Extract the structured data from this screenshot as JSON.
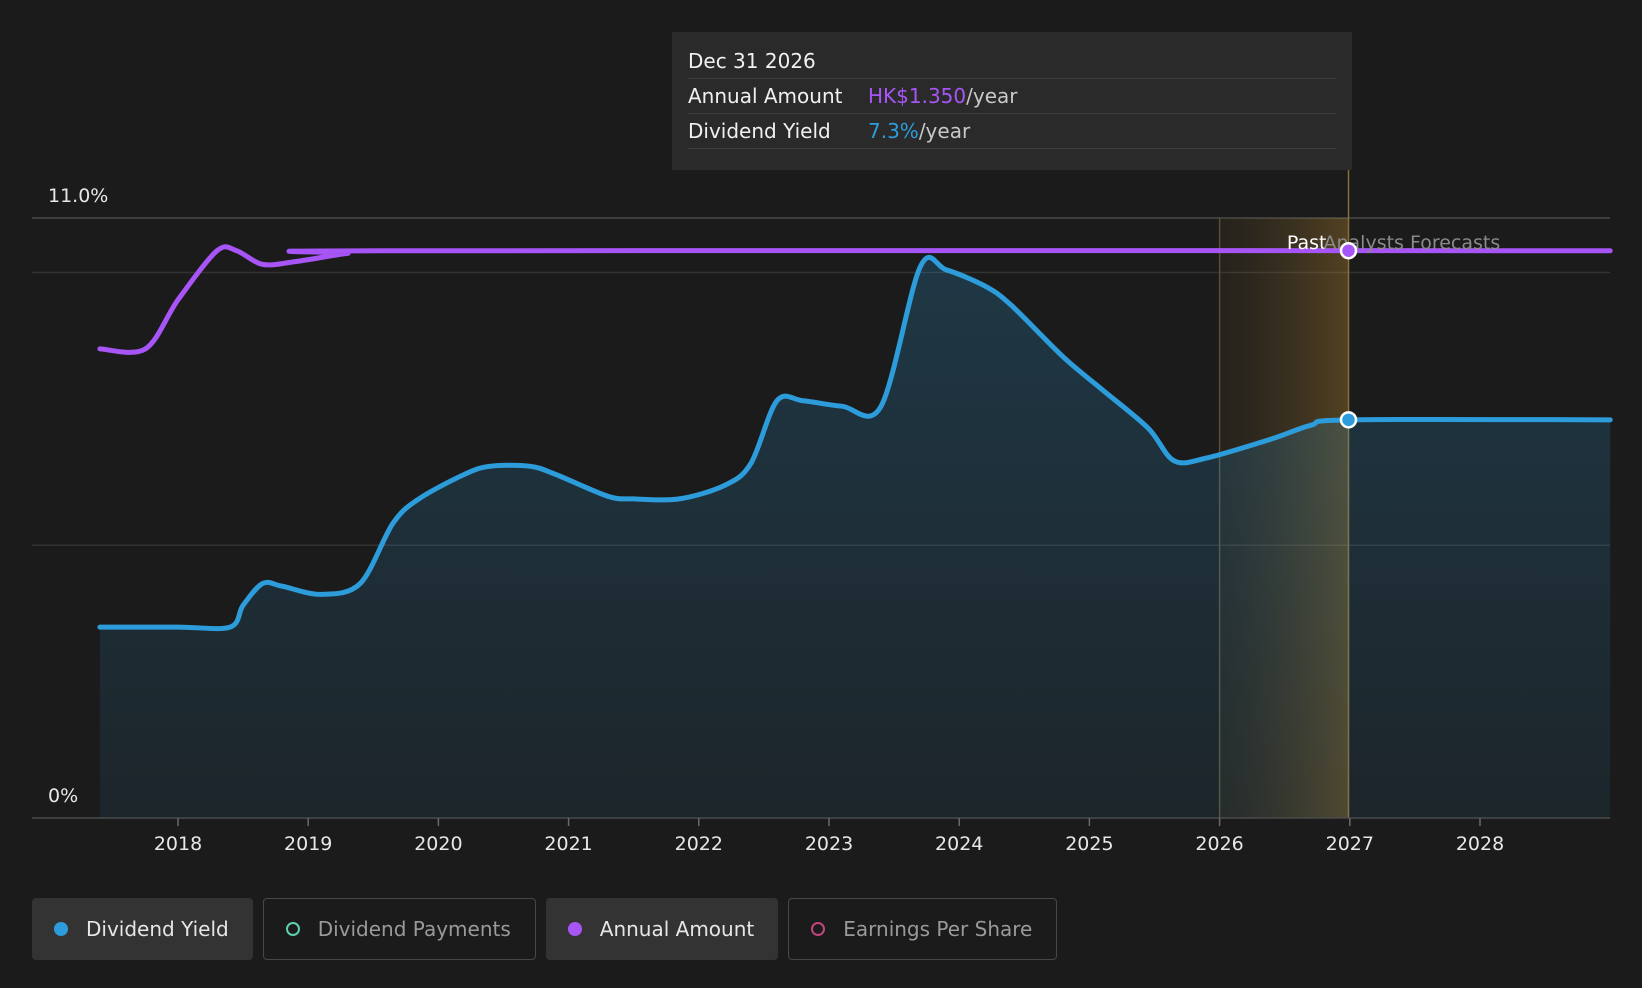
{
  "chart_data": {
    "type": "area",
    "x_range": [
      2017.4,
      2029.0
    ],
    "x_ticks": [
      "2018",
      "2019",
      "2020",
      "2021",
      "2022",
      "2023",
      "2024",
      "2025",
      "2026",
      "2027",
      "2028"
    ],
    "y_axis": {
      "top_label": "11.0%",
      "bottom_label": "0%",
      "ylim": [
        0,
        11.0
      ]
    },
    "series": [
      {
        "name": "Dividend Yield",
        "color": "#2d9cdb",
        "unit": "%",
        "points": [
          [
            2017.4,
            3.5
          ],
          [
            2018.0,
            3.5
          ],
          [
            2018.4,
            3.5
          ],
          [
            2018.5,
            3.9
          ],
          [
            2018.65,
            4.3
          ],
          [
            2018.8,
            4.25
          ],
          [
            2019.1,
            4.1
          ],
          [
            2019.4,
            4.3
          ],
          [
            2019.65,
            5.4
          ],
          [
            2019.85,
            5.85
          ],
          [
            2020.2,
            6.3
          ],
          [
            2020.4,
            6.45
          ],
          [
            2020.7,
            6.45
          ],
          [
            2020.9,
            6.3
          ],
          [
            2021.3,
            5.9
          ],
          [
            2021.5,
            5.85
          ],
          [
            2021.85,
            5.85
          ],
          [
            2022.2,
            6.1
          ],
          [
            2022.4,
            6.5
          ],
          [
            2022.6,
            7.65
          ],
          [
            2022.8,
            7.65
          ],
          [
            2023.1,
            7.55
          ],
          [
            2023.4,
            7.55
          ],
          [
            2023.7,
            10.1
          ],
          [
            2023.9,
            10.05
          ],
          [
            2024.2,
            9.75
          ],
          [
            2024.4,
            9.4
          ],
          [
            2024.8,
            8.45
          ],
          [
            2025.1,
            7.85
          ],
          [
            2025.45,
            7.15
          ],
          [
            2025.65,
            6.55
          ],
          [
            2025.9,
            6.6
          ],
          [
            2026.4,
            6.95
          ],
          [
            2026.7,
            7.2
          ],
          [
            2027.0,
            7.3
          ],
          [
            2029.0,
            7.3
          ]
        ]
      },
      {
        "name": "Annual Amount",
        "color": "#a855f7",
        "points": [
          [
            2017.4,
            8.6
          ],
          [
            2017.75,
            8.6
          ],
          [
            2018.0,
            9.5
          ],
          [
            2018.3,
            10.4
          ],
          [
            2018.45,
            10.4
          ],
          [
            2018.65,
            10.15
          ],
          [
            2018.9,
            10.2
          ],
          [
            2019.3,
            10.35
          ],
          [
            2019.6,
            10.4
          ],
          [
            2029.0,
            10.4
          ]
        ]
      }
    ],
    "highlight": {
      "x": 2026.99,
      "past_label": "Past",
      "forecast_label": "Analysts Forecasts",
      "band_start": 2026.0
    }
  },
  "tooltip": {
    "date": "Dec 31 2026",
    "annual_amount_label": "Annual Amount",
    "annual_amount_value": "HK$1.350",
    "annual_amount_unit": "/year",
    "dividend_yield_label": "Dividend Yield",
    "dividend_yield_value": "7.3%",
    "dividend_yield_unit": "/year"
  },
  "legend": [
    {
      "label": "Dividend Yield",
      "color": "#2d9cdb",
      "active": true,
      "filled": true
    },
    {
      "label": "Dividend Payments",
      "color": "#5ecfb1",
      "active": false,
      "filled": false
    },
    {
      "label": "Annual Amount",
      "color": "#a855f7",
      "active": true,
      "filled": true
    },
    {
      "label": "Earnings Per Share",
      "color": "#c2447a",
      "active": false,
      "filled": false
    }
  ]
}
